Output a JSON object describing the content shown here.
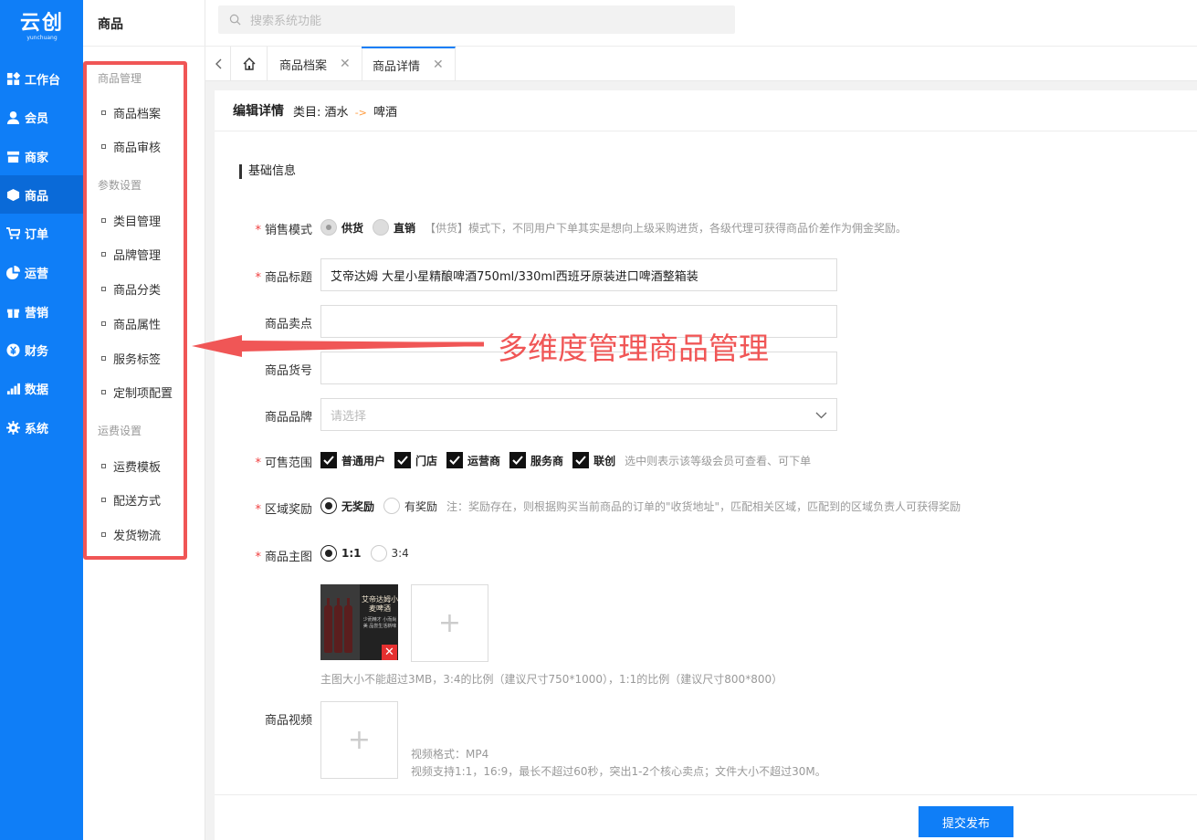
{
  "logo": {
    "main": "云创",
    "sub": "yunchuang"
  },
  "nav": [
    {
      "label": "工作台",
      "icon": "workbench-icon"
    },
    {
      "label": "会员",
      "icon": "user-icon"
    },
    {
      "label": "商家",
      "icon": "store-icon"
    },
    {
      "label": "商品",
      "icon": "box-icon",
      "active": true
    },
    {
      "label": "订单",
      "icon": "cart-icon"
    },
    {
      "label": "运营",
      "icon": "pie-icon"
    },
    {
      "label": "营销",
      "icon": "gift-icon"
    },
    {
      "label": "财务",
      "icon": "yen-icon"
    },
    {
      "label": "数据",
      "icon": "bars-icon"
    },
    {
      "label": "系统",
      "icon": "gear-icon"
    }
  ],
  "sidebar": {
    "title": "商品",
    "groups": [
      {
        "label": "商品管理",
        "items": [
          "商品档案",
          "商品审核"
        ]
      },
      {
        "label": "参数设置",
        "items": [
          "类目管理",
          "品牌管理",
          "商品分类",
          "商品属性",
          "服务标签",
          "定制项配置"
        ]
      },
      {
        "label": "运费设置",
        "items": [
          "运费模板",
          "配送方式",
          "发货物流"
        ]
      }
    ]
  },
  "search": {
    "placeholder": "搜索系统功能"
  },
  "tabs": [
    {
      "label": "商品档案"
    },
    {
      "label": "商品详情",
      "active": true
    }
  ],
  "card": {
    "title": "编辑详情",
    "category_prefix": "类目:",
    "category_from": "酒水",
    "category_arrow": "->",
    "category_to": "啤酒"
  },
  "section_title": "基础信息",
  "form": {
    "sale_mode": {
      "label": "销售模式",
      "options": [
        "供货",
        "直销"
      ],
      "hint": "【供货】模式下，不同用户下单其实是想向上级采购进货，各级代理可获得商品价差作为佣金奖励。"
    },
    "title": {
      "label": "商品标题",
      "value": "艾帝达姆 大星小星精酿啤酒750ml/330ml西班牙原装进口啤酒整箱装"
    },
    "selling_point": {
      "label": "商品卖点",
      "value": ""
    },
    "sku_no": {
      "label": "商品货号",
      "value": ""
    },
    "brand": {
      "label": "商品品牌",
      "placeholder": "请选择"
    },
    "scope": {
      "label": "可售范围",
      "options": [
        "普通用户",
        "门店",
        "运营商",
        "服务商",
        "联创"
      ],
      "hint": "选中则表示该等级会员可查看、可下单"
    },
    "region_reward": {
      "label": "区域奖励",
      "options": [
        "无奖励",
        "有奖励"
      ],
      "hint": "注：奖励存在，则根据购买当前商品的订单的\"收货地址\"，匹配相关区域，匹配到的区域负责人可获得奖励"
    },
    "main_image": {
      "label": "商品主图",
      "options": [
        "1:1",
        "3:4"
      ],
      "thumb_text": "艾帝达姆小麦啤酒",
      "thumb_sub": "少而精才 小而尚美 品尝生活新味",
      "hint": "主图大小不能超过3MB，3:4的比例（建议尺寸750*1000），1:1的比例（建议尺寸800*800）"
    },
    "video": {
      "label": "商品视频",
      "format": "视频格式：MP4",
      "hint": "视频支持1:1，16:9，最长不超过60秒，突出1-2个核心卖点；文件大小不超过30M。"
    }
  },
  "submit_label": "提交发布",
  "annotation": "多维度管理商品管理",
  "colors": {
    "primary": "#0f7ef7",
    "annotation": "#f05656"
  }
}
